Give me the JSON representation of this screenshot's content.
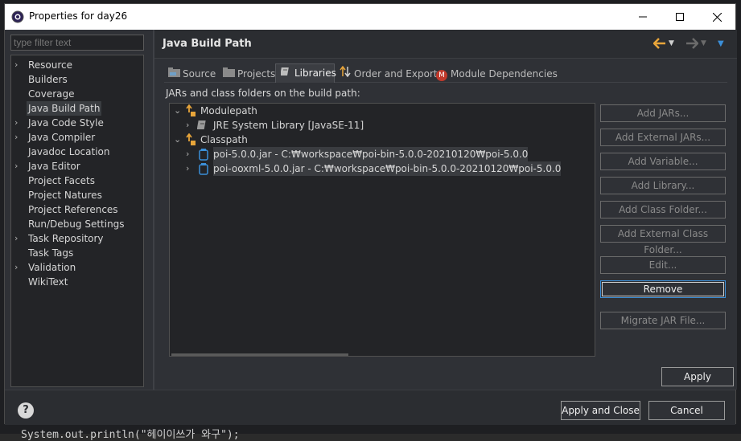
{
  "background": {
    "code_line": "System.out.println(\"헤이이쓰가 와구\");"
  },
  "window": {
    "title": "Properties for day26",
    "controls": {
      "minimize": "—",
      "maximize": "☐",
      "close": "✕"
    }
  },
  "sidebar": {
    "filter_placeholder": "type filter text",
    "items": [
      {
        "label": "Resource",
        "expandable": true
      },
      {
        "label": "Builders",
        "expandable": false
      },
      {
        "label": "Coverage",
        "expandable": false
      },
      {
        "label": "Java Build Path",
        "expandable": false,
        "selected": true
      },
      {
        "label": "Java Code Style",
        "expandable": true
      },
      {
        "label": "Java Compiler",
        "expandable": true
      },
      {
        "label": "Javadoc Location",
        "expandable": false
      },
      {
        "label": "Java Editor",
        "expandable": true
      },
      {
        "label": "Project Facets",
        "expandable": false
      },
      {
        "label": "Project Natures",
        "expandable": false
      },
      {
        "label": "Project References",
        "expandable": false
      },
      {
        "label": "Run/Debug Settings",
        "expandable": false
      },
      {
        "label": "Task Repository",
        "expandable": true
      },
      {
        "label": "Task Tags",
        "expandable": false
      },
      {
        "label": "Validation",
        "expandable": true
      },
      {
        "label": "WikiText",
        "expandable": false
      }
    ]
  },
  "page": {
    "title": "Java Build Path",
    "tabs": [
      {
        "label": "Source",
        "icon": "source-folder-icon"
      },
      {
        "label": "Projects",
        "icon": "projects-folder-icon"
      },
      {
        "label": "Libraries",
        "icon": "library-book-icon",
        "active": true
      },
      {
        "label": "Order and Export",
        "icon": "order-arrows-icon"
      },
      {
        "label": "Module Dependencies",
        "icon": "module-m-icon"
      }
    ],
    "section_label": "JARs and class folders on the build path:",
    "tree": {
      "modulepath": {
        "label": "Modulepath",
        "children": [
          {
            "label": "JRE System Library [JavaSE-11]"
          }
        ]
      },
      "classpath": {
        "label": "Classpath",
        "children": [
          {
            "label": "poi-5.0.0.jar - C:₩workspace₩poi-bin-5.0.0-20210120₩poi-5.0.0"
          },
          {
            "label": "poi-ooxml-5.0.0.jar - C:₩workspace₩poi-bin-5.0.0-20210120₩poi-5.0.0"
          }
        ]
      }
    },
    "buttons": {
      "add_jars": "Add JARs...",
      "add_external_jars": "Add External JARs...",
      "add_variable": "Add Variable...",
      "add_library": "Add Library...",
      "add_class_folder": "Add Class Folder...",
      "add_external_class_folder": "Add External Class Folder...",
      "edit": "Edit...",
      "remove": "Remove",
      "migrate_jar": "Migrate JAR File..."
    },
    "apply": "Apply"
  },
  "footer": {
    "help": "?",
    "apply_and_close": "Apply and Close",
    "cancel": "Cancel"
  },
  "colors": {
    "accent": "#3b8fd8",
    "nav_back": "#e8a53a",
    "selection": "#3a3d41"
  }
}
